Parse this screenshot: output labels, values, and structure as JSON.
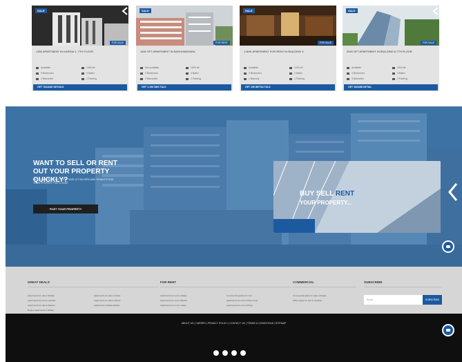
{
  "listings": [
    {
      "badge": "SALE",
      "for_label": "FOR SALE",
      "title": "1350 APARTMENT IN KARIGA 1, 7TH FLOOR",
      "features": [
        "Available",
        "1350 sft",
        "3 Bedrooms",
        "3 Baths",
        "2 Balconies",
        "1 Parking"
      ],
      "cta": "GET TAKADD DETAILS"
    },
    {
      "badge": "SALE",
      "for_label": "FOR RENT",
      "title": "1500 SFT APARTMENT IN BASHUNDHARA",
      "features": [
        "Not available",
        "1500 sft",
        "3 Bedrooms",
        "3 Baths",
        "2 Balconies",
        "1 Parking"
      ],
      "cta": "GET 1-190 SMS TALK"
    },
    {
      "badge": "SALE",
      "for_label": "FOR SALE",
      "title": "1 BHK APARTMENT FOR RENT IN BUILDING 4",
      "features": [
        "Available",
        "1200 sft",
        "2 Bedrooms",
        "2 Baths",
        "1 Balcony",
        "1 Parking"
      ],
      "cta": "GET 190 BETSA TALK"
    },
    {
      "badge": "SALE",
      "for_label": "FOR SALE",
      "title": "2540 SFT APARTMENT IN BUILDING 6,7TH FLOOR",
      "features": [
        "Available",
        "2540 sft",
        "4 Bedrooms",
        "4 Baths",
        "3 Balconies",
        "2 Parking"
      ],
      "cta": "GET 182AB8 DETAIL"
    }
  ],
  "hero": {
    "title": "WANT TO SELL OR RENT OUT YOUR PROPERTY QUICKLY?",
    "subtitle": "LIST YOUR PROPERTY TODAY AND LET BUYERS AND TENANTS FIND YOUR PROPERTY WITH EASE",
    "button": "POST YOUR PROPERTY",
    "promo_line1_a": "BUY SELL ",
    "promo_line1_b": "RENT",
    "promo_line2": "YOUR PROPERTY..."
  },
  "footer": {
    "cols": [
      {
        "title": "GREAT DEALS",
        "links": [
          "Apartments for sale in Dhaka",
          "Apartments for rent in Gulshan",
          "Apartments for sale in Banani",
          "Duplex apartments in Dhaka",
          "Apartments for sale in Uttara",
          "Apartments for sale in Mirpur",
          "Apartments in Bashundhara"
        ]
      },
      {
        "title": "FOR RENT",
        "links": [
          "Apartments for rent in Dhaka",
          "Apartments for rent in Banani",
          "Apartments for rent in Uttara",
          "Commercial spaces for rent",
          "Apartments for rent in Dhanmondi",
          "Apartments for rent in Mirpur"
        ]
      },
      {
        "title": "COMMERCIAL",
        "links": [
          "Commercial space for sale in Dhaka",
          "Office space for rent in Gulshan"
        ]
      },
      {
        "title": "SUBSCRIBE",
        "links": []
      }
    ],
    "subscribe_placeholder": "Email",
    "subscribe_button": "SUBSCRIBE",
    "legal": "ABOUT US  |  CAREER  |  PRIVACY POLICY  |  CONTACT US  |  TERMS & CONDITIONS  |  SITEMAP",
    "social": [
      "facebook-icon",
      "twitter-icon",
      "linkedin-icon",
      "youtube-icon"
    ]
  },
  "colors": {
    "brand_blue": "#1c5aa0",
    "hero_blue": "#3d72a4",
    "footer_dark": "#0f0f0f",
    "footer_light": "#d6d6d6"
  }
}
